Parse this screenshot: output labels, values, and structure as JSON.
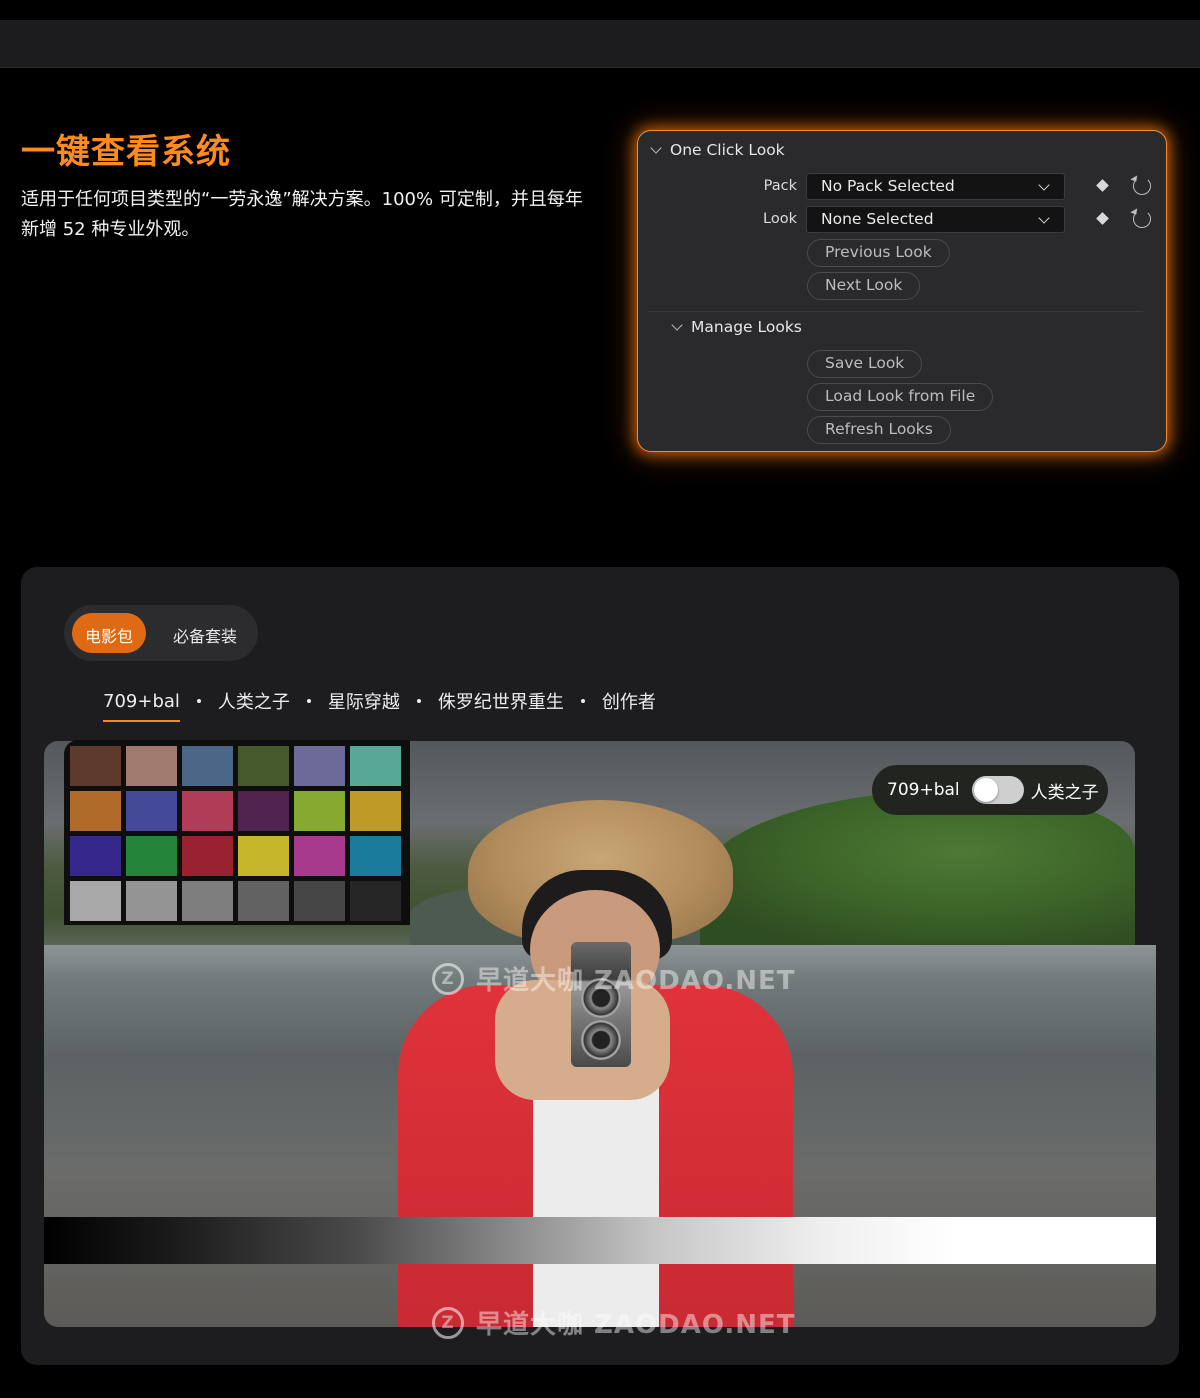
{
  "hero": {
    "title": "一键查看系统",
    "description": "适用于任何项目类型的“一劳永逸”解决方案。100% 可定制，并且每年新增 52 种专业外观。"
  },
  "panel": {
    "section_title": "One Click Look",
    "pack_label": "Pack",
    "pack_value": "No Pack Selected",
    "look_label": "Look",
    "look_value": "None Selected",
    "previous_look": "Previous Look",
    "next_look": "Next Look",
    "manage_title": "Manage Looks",
    "save_look": "Save Look",
    "load_look": "Load Look from File",
    "refresh_looks": "Refresh Looks",
    "accent": "#ff8a1f"
  },
  "showcase": {
    "segments": [
      "电影包",
      "必备套装"
    ],
    "active_segment": "电影包",
    "looks": [
      "709+bal",
      "人类之子",
      "星际穿越",
      "侏罗纪世界重生",
      "创作者"
    ],
    "active_look": "709+bal",
    "compare": {
      "left": "709+bal",
      "right": "人类之子"
    },
    "checker_colors": [
      "#5e3a2c",
      "#a07a6c",
      "#4c6688",
      "#46592d",
      "#6c6a98",
      "#58a898",
      "#b06a2a",
      "#444a98",
      "#b03c58",
      "#50244e",
      "#86aa30",
      "#c09a26",
      "#36288a",
      "#24843a",
      "#9a2230",
      "#c6b62a",
      "#a83a8e",
      "#1a7c9a",
      "#a8a8a8",
      "#949494",
      "#7e7e7e",
      "#626262",
      "#464646",
      "#262626"
    ]
  },
  "watermark": {
    "logo": "Z",
    "text": "早道大咖 ZAODAO.NET"
  }
}
